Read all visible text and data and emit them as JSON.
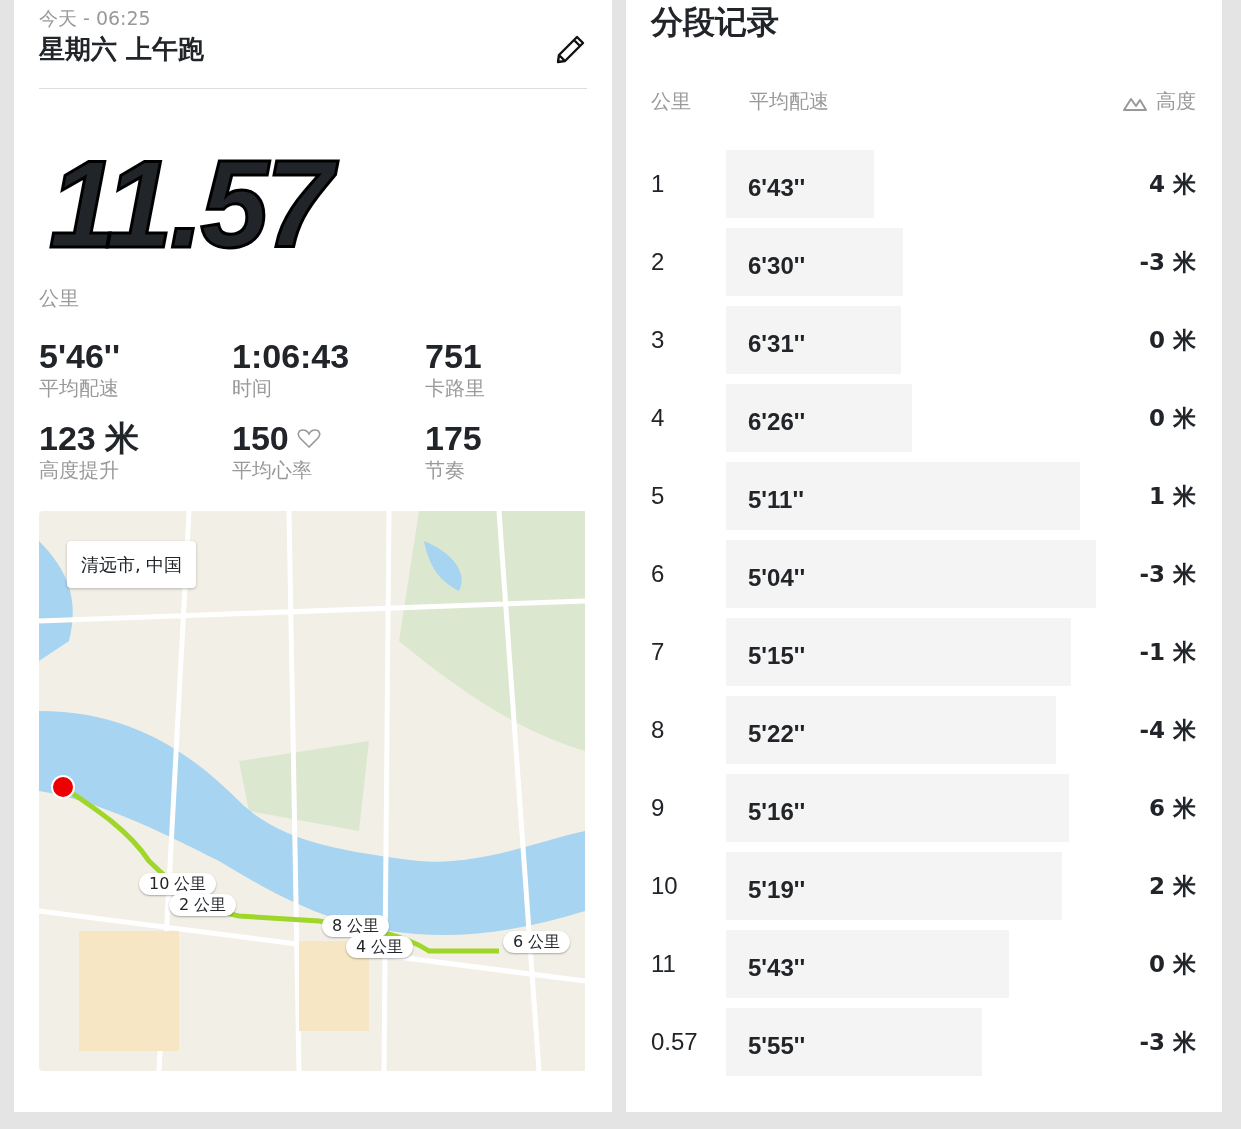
{
  "activity": {
    "date": "今天 - 06:25",
    "title": "星期六  上午跑",
    "distance": "11.57",
    "distance_unit": "公里",
    "stats": [
      {
        "value": "5'46''",
        "label": "平均配速",
        "kind": "plain"
      },
      {
        "value": "1:06:43",
        "label": "时间",
        "kind": "plain"
      },
      {
        "value": "751",
        "label": "卡路里",
        "kind": "plain"
      },
      {
        "value": "123 米",
        "label": "高度提升",
        "kind": "plain"
      },
      {
        "value": "150",
        "label": "平均心率",
        "kind": "heart"
      },
      {
        "value": "175",
        "label": "节奏",
        "kind": "plain"
      }
    ],
    "map": {
      "kind": "picture",
      "location": "清远市, 中国",
      "markers": [
        {
          "label": "10 公里"
        },
        {
          "label": "2 公里"
        },
        {
          "label": "8 公里"
        },
        {
          "label": "4 公里"
        },
        {
          "label": "6 公里"
        }
      ]
    }
  },
  "splits": {
    "title": "分段记录",
    "columns": [
      "公里",
      "平均配速",
      "高度"
    ],
    "rows": [
      {
        "km": "1",
        "pace": "6'43''",
        "elevation": "4 米"
      },
      {
        "km": "2",
        "pace": "6'30''",
        "elevation": "-3 米"
      },
      {
        "km": "3",
        "pace": "6'31''",
        "elevation": "0 米"
      },
      {
        "km": "4",
        "pace": "6'26''",
        "elevation": "0 米"
      },
      {
        "km": "5",
        "pace": "5'11''",
        "elevation": "1 米"
      },
      {
        "km": "6",
        "pace": "5'04''",
        "elevation": "-3 米"
      },
      {
        "km": "7",
        "pace": "5'15''",
        "elevation": "-1 米"
      },
      {
        "km": "8",
        "pace": "5'22''",
        "elevation": "-4 米"
      },
      {
        "km": "9",
        "pace": "5'16''",
        "elevation": "6 米"
      },
      {
        "km": "10",
        "pace": "5'19''",
        "elevation": "2 米"
      },
      {
        "km": "11",
        "pace": "5'43''",
        "elevation": "0 米"
      },
      {
        "km": "0.57",
        "pace": "5'55''",
        "elevation": "-3 米"
      }
    ]
  }
}
